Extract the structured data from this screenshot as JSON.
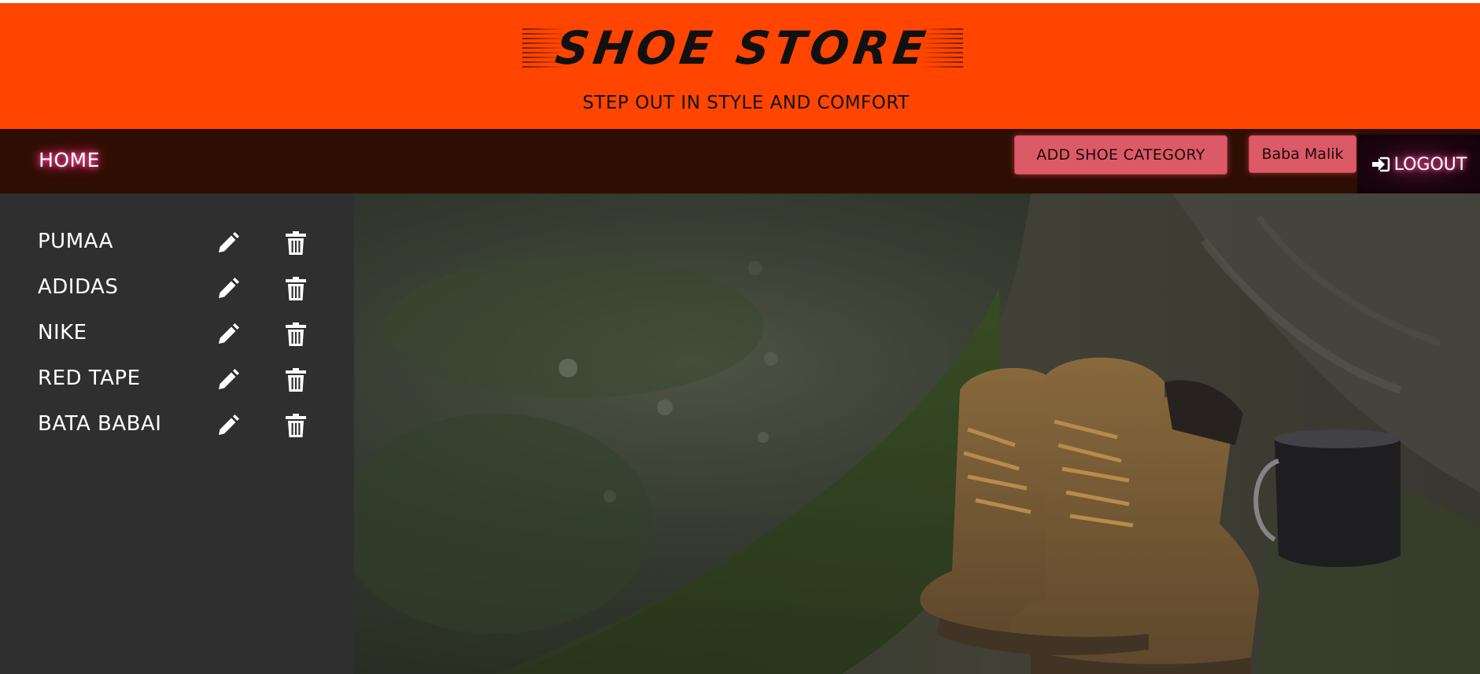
{
  "header": {
    "logo_text": "SHOE STORE",
    "tagline": "STEP OUT IN STYLE AND COMFORT",
    "background_color": "#ff4500"
  },
  "navbar": {
    "home_label": "HOME",
    "add_category_label": "ADD SHOE CATEGORY",
    "user_label": "Baba Malik",
    "logout_label": "LOGOUT",
    "logout_icon": "sign-in-arrow-icon",
    "background_color": "#2e0e02",
    "button_color": "#dc5a67"
  },
  "sidebar": {
    "categories": [
      {
        "name": "PUMAA",
        "edit_icon": "pencil-icon",
        "delete_icon": "trash-icon"
      },
      {
        "name": "ADIDAS",
        "edit_icon": "pencil-icon",
        "delete_icon": "trash-icon"
      },
      {
        "name": "NIKE",
        "edit_icon": "pencil-icon",
        "delete_icon": "trash-icon"
      },
      {
        "name": "RED TAPE",
        "edit_icon": "pencil-icon",
        "delete_icon": "trash-icon"
      },
      {
        "name": "BATA BABAI",
        "edit_icon": "pencil-icon",
        "delete_icon": "trash-icon"
      }
    ],
    "background_color": "#2f2f2f"
  },
  "hero": {
    "image_subject": "boots-on-mossy-tree-photo"
  }
}
